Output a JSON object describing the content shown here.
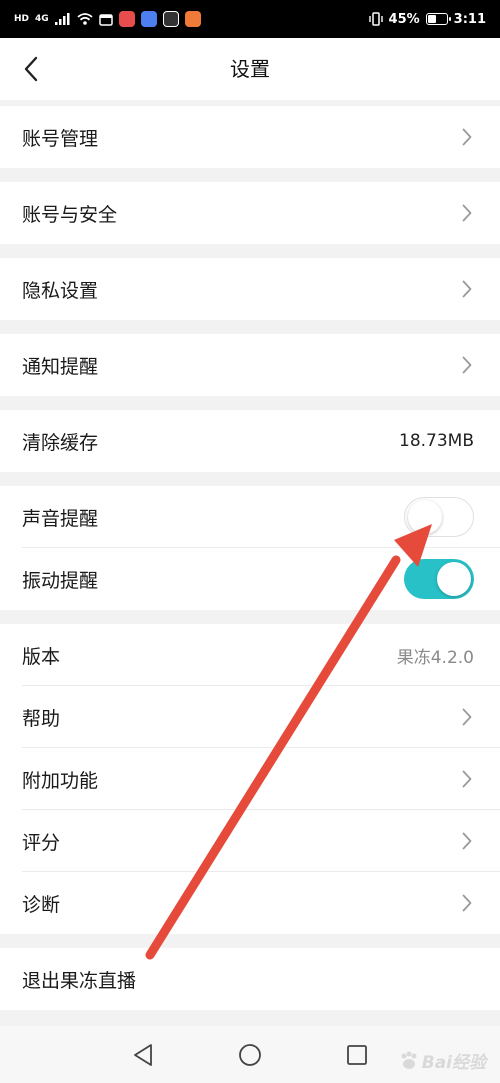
{
  "status_bar": {
    "network_badge": "HD",
    "network_type": "4G",
    "battery_percent": "45%",
    "battery_level": 0.45,
    "time": "3:11"
  },
  "header": {
    "title": "设置"
  },
  "settings": {
    "account_management": "账号管理",
    "account_security": "账号与安全",
    "privacy_settings": "隐私设置",
    "notification_reminder": "通知提醒",
    "clear_cache": {
      "label": "清除缓存",
      "value": "18.73MB"
    },
    "sound_reminder": {
      "label": "声音提醒",
      "enabled": false
    },
    "vibration_reminder": {
      "label": "振动提醒",
      "enabled": true
    },
    "version": {
      "label": "版本",
      "value": "果冻4.2.0"
    },
    "help": "帮助",
    "extra_features": "附加功能",
    "rating": "评分",
    "diagnosis": "诊断",
    "logout": "退出果冻直播"
  },
  "watermark": {
    "text": "Bai经验"
  },
  "colors": {
    "toggle_on": "#27c1c7",
    "arrow": "#e64a3b",
    "chevron": "#9a9a9a"
  }
}
